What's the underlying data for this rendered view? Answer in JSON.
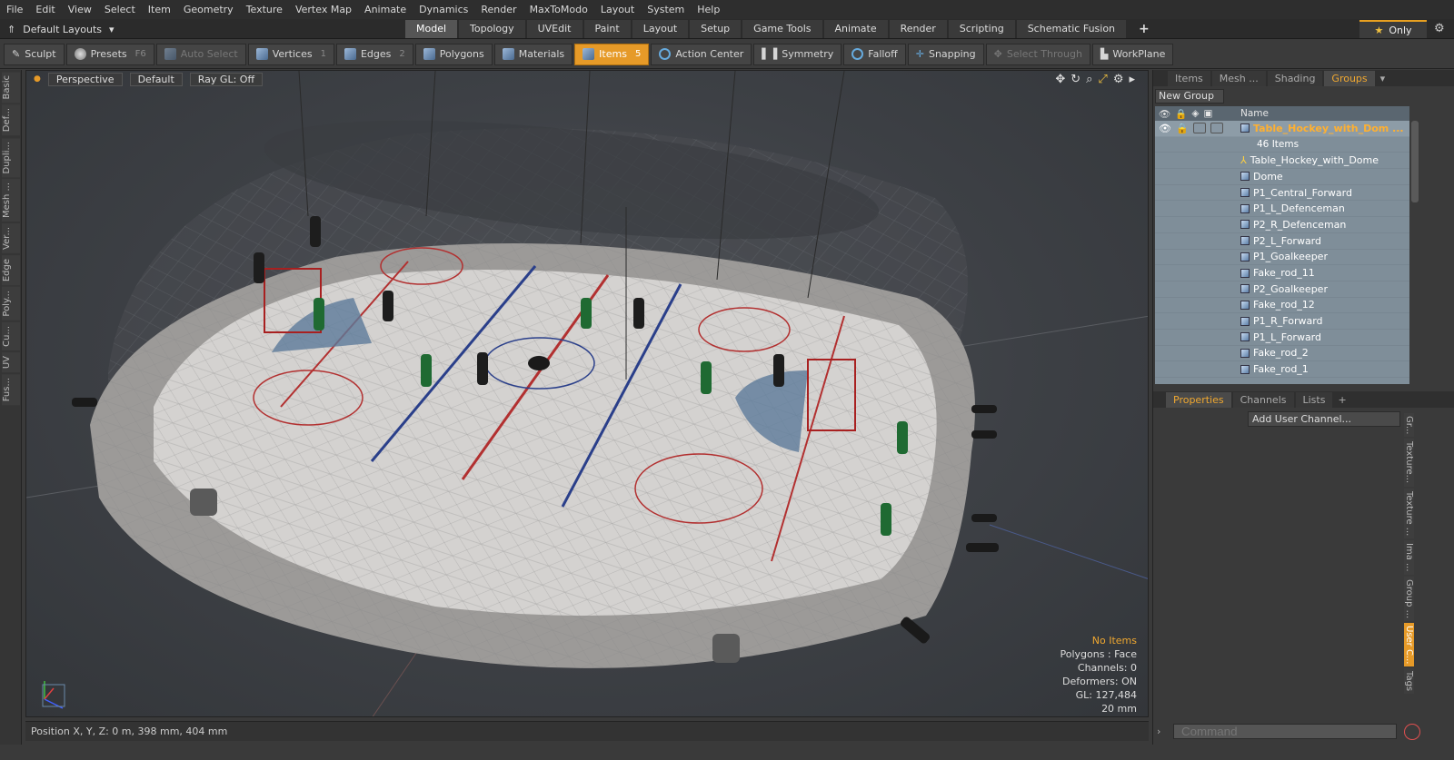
{
  "menu": [
    "File",
    "Edit",
    "View",
    "Select",
    "Item",
    "Geometry",
    "Texture",
    "Vertex Map",
    "Animate",
    "Dynamics",
    "Render",
    "MaxToModo",
    "Layout",
    "System",
    "Help"
  ],
  "layouts_label": "Default Layouts",
  "tabs": [
    "Model",
    "Topology",
    "UVEdit",
    "Paint",
    "Layout",
    "Setup",
    "Game Tools",
    "Animate",
    "Render",
    "Scripting",
    "Schematic Fusion"
  ],
  "only_label": "Only",
  "toolbar": {
    "sculpt": "Sculpt",
    "presets": "Presets",
    "presets_key": "F6",
    "auto_select": "Auto Select",
    "vertices": "Vertices",
    "vertices_key": "1",
    "edges": "Edges",
    "edges_key": "2",
    "polygons": "Polygons",
    "materials": "Materials",
    "items": "Items",
    "items_key": "5",
    "action_center": "Action Center",
    "symmetry": "Symmetry",
    "falloff": "Falloff",
    "snapping": "Snapping",
    "select_through": "Select Through",
    "workplane": "WorkPlane"
  },
  "left_tabs": [
    "Basic",
    "Def...",
    "Dupli...",
    "Mesh ...",
    "Ver...",
    "Edge",
    "Poly...",
    "Cu...",
    "UV",
    "Fus..."
  ],
  "viewport": {
    "view": "Perspective",
    "shading": "Default",
    "raygl": "Ray GL: Off",
    "stats": {
      "items": "No Items",
      "polygons": "Polygons : Face",
      "channels": "Channels: 0",
      "deformers": "Deformers: ON",
      "gl": "GL: 127,484",
      "unit": "20 mm"
    }
  },
  "status_position": "Position X, Y, Z:  0 m, 398 mm, 404 mm",
  "panel_tabs": [
    "Items",
    "Mesh ...",
    "Shading",
    "Groups"
  ],
  "new_group": "New Group",
  "tree": {
    "col_name": "Name",
    "group_name": "Table_Hockey_with_Dom ...",
    "group_count": "46 Items",
    "items": [
      "Table_Hockey_with_Dome",
      "Dome",
      "P1_Central_Forward",
      "P1_L_Defenceman",
      "P2_R_Defenceman",
      "P2_L_Forward",
      "P1_Goalkeeper",
      "Fake_rod_11",
      "P2_Goalkeeper",
      "Fake_rod_12",
      "P1_R_Forward",
      "P1_L_Forward",
      "Fake_rod_2",
      "Fake_rod_1"
    ]
  },
  "prop_tabs": [
    "Properties",
    "Channels",
    "Lists"
  ],
  "add_channel": "Add User Channel...",
  "right_tabs": [
    "Gr...",
    "Texture...",
    "Texture ...",
    "Ima ...",
    "Group ...",
    "User C...",
    "Tags"
  ],
  "command_placeholder": "Command"
}
